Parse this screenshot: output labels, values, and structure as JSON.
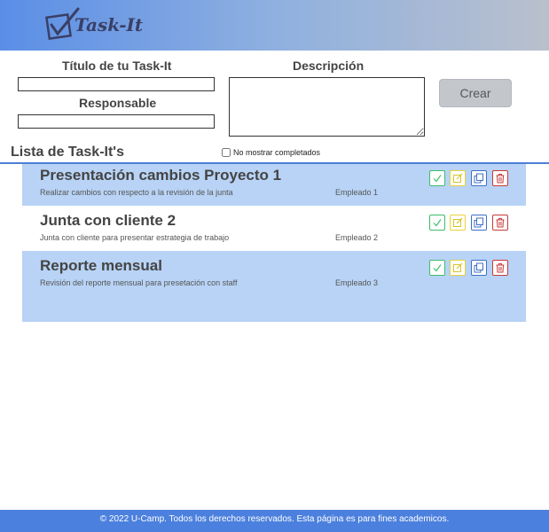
{
  "app": {
    "logo_text": "Task-It",
    "accent_color": "#4c80de"
  },
  "form": {
    "title_label": "Título de tu Task-It",
    "title_value": "",
    "responsible_label": "Responsable",
    "responsible_value": "",
    "description_label": "Descripción",
    "description_value": "",
    "create_button": "Crear"
  },
  "list": {
    "heading": "Lista de Task-It's",
    "hide_completed_label": "No mostrar completados",
    "hide_completed_checked": false,
    "tasks": [
      {
        "title": "Presentación cambios Proyecto 1",
        "description": "Realizar cambios con respecto a la revisión de la junta",
        "responsible": "Empleado 1"
      },
      {
        "title": "Junta con cliente 2",
        "description": "Junta con cliente para presentar estrategia de trabajo",
        "responsible": "Empleado 2"
      },
      {
        "title": "Reporte mensual",
        "description": "Revisión del reporte mensual para presetación con staff",
        "responsible": "Empleado 3"
      }
    ],
    "action_icons": [
      "check-icon",
      "edit-icon",
      "copy-icon",
      "trash-icon"
    ]
  },
  "footer": {
    "text": "© 2022 U-Camp. Todos los derechos reservados. Esta página es para fines academicos."
  }
}
